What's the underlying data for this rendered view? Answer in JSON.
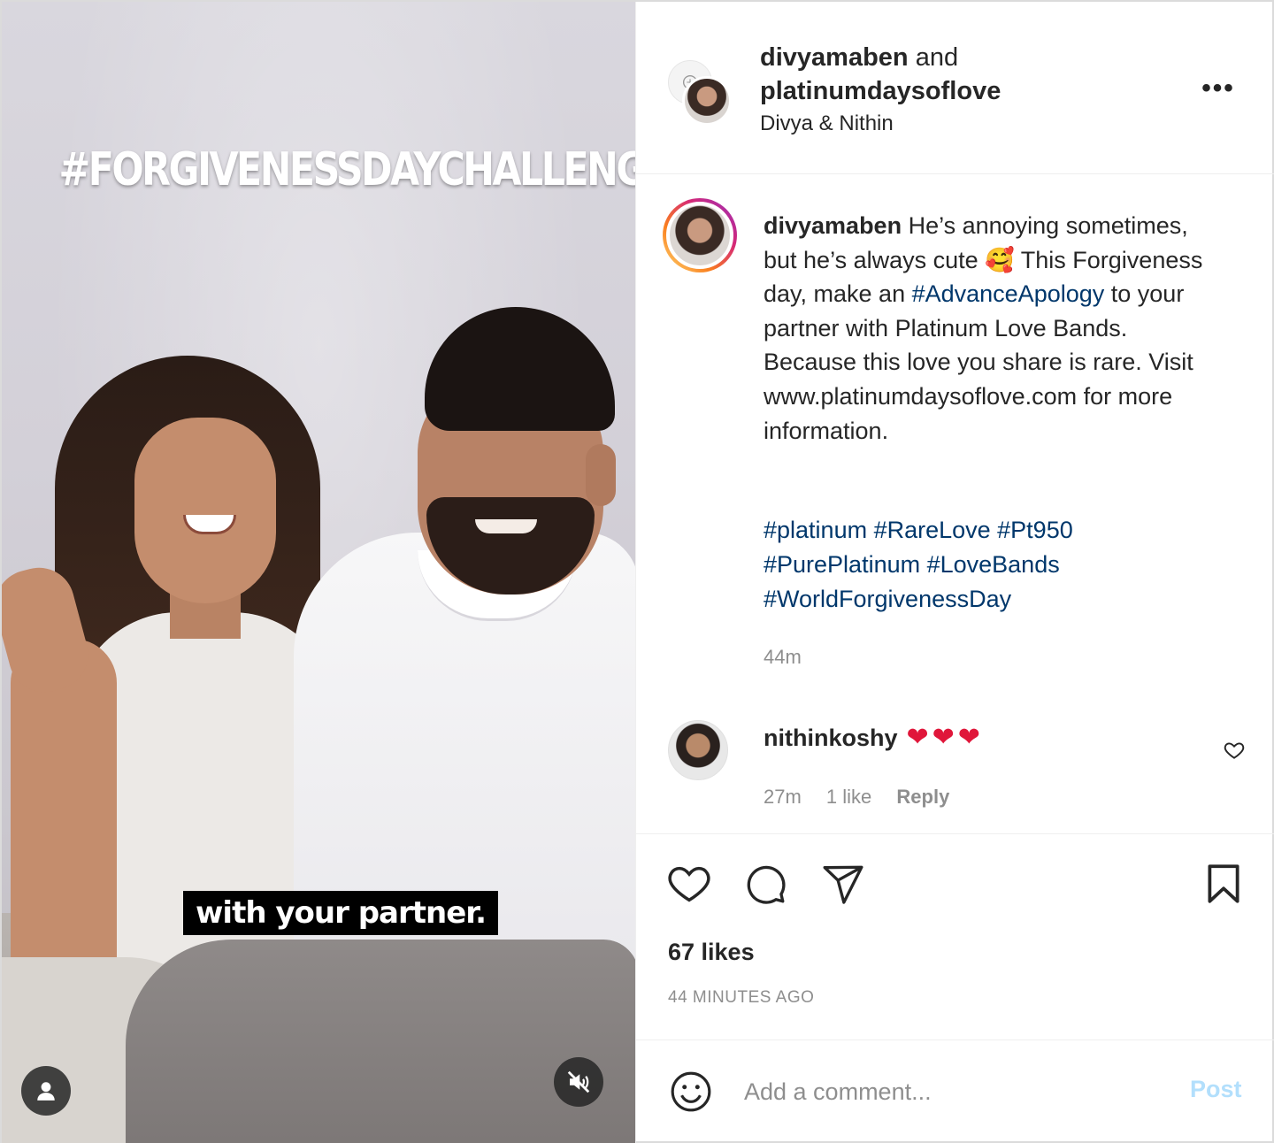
{
  "media": {
    "overlay_title": "#FORGIVENESSDAYCHALLENGE",
    "subtitle": "with your partner."
  },
  "header": {
    "username_primary": "divyamaben",
    "joiner": "and",
    "username_secondary": "platinumdaysoflove",
    "subtitle": "Divya & Nithin",
    "more_label": "•••"
  },
  "caption": {
    "username": "divyamaben",
    "text_part1": " He’s annoying sometimes, but he’s always cute 🥰 This Forgiveness day, make an ",
    "hashtag_inline": "#AdvanceApology",
    "text_part2": " to your partner with Platinum Love Bands. Because this love you share is rare. Visit www.platinumdaysoflove.com for more information.",
    "hashtags_line1": "#platinum #RareLove #Pt950",
    "hashtags_line2": "#PurePlatinum #LoveBands",
    "hashtags_line3": "#WorldForgivenessDay",
    "time": "44m"
  },
  "comment": {
    "username": "nithinkoshy",
    "hearts": "❤❤❤",
    "time": "27m",
    "likes": "1 like",
    "reply": "Reply"
  },
  "actions": {
    "likes": "67 likes",
    "ago": "44 MINUTES AGO"
  },
  "add_comment": {
    "placeholder": "Add a comment...",
    "post_label": "Post"
  },
  "colors": {
    "hashtag": "#00376b",
    "post_disabled": "#b2dffc",
    "secondary_text": "#8e8e8e",
    "heart_red": "#e0163a"
  },
  "icons": [
    "user-tag-icon",
    "mute-icon",
    "more-icon",
    "heart-icon",
    "comment-icon",
    "share-icon",
    "bookmark-icon",
    "emoji-icon"
  ]
}
